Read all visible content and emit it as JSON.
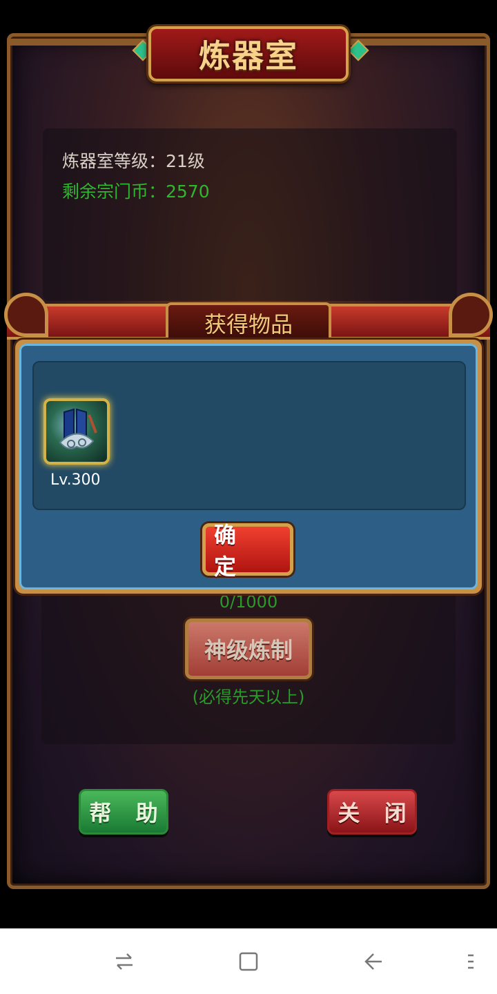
{
  "title": "炼器室",
  "info": {
    "level_text": "炼器室等级：21级",
    "coins_text": "剩余宗门币：2570"
  },
  "dialog": {
    "header": "获得物品",
    "items": [
      {
        "icon": "weapon-fan-icon",
        "level": "Lv.300"
      }
    ],
    "confirm_label": "确 定"
  },
  "refine": {
    "progress": "0/1000",
    "button_label": "神级炼制",
    "note": "(必得先天以上)"
  },
  "buttons": {
    "help": "帮 助",
    "close": "关 闭"
  },
  "navbar": {
    "icons": [
      "recent-apps-icon",
      "home-icon",
      "back-icon",
      "menu-icon"
    ]
  }
}
